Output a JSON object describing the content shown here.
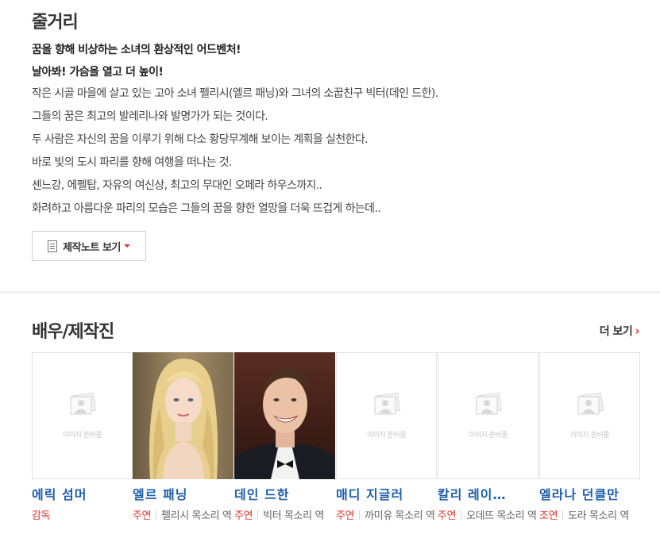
{
  "synopsis": {
    "title": "줄거리",
    "headline1": "꿈을 향해 비상하는 소녀의 환상적인 어드벤처!",
    "headline2": "날아봐! 가슴을 열고 더 높이!",
    "lines": [
      "작은 시골 마을에 살고 있는 고아 소녀 펠리시(엘르 패닝)와 그녀의 소꿉친구 빅터(데인 드한).",
      " 그들의 꿈은 최고의 발레리나와 발명가가 되는 것이다.",
      " 두 사람은 자신의 꿈을 이루기 위해 다소 황당무계해 보이는 계획을 실천한다.",
      " 바로 빛의 도시 파리를 향해 여행을 떠나는 것.",
      " 센느강, 에펠탑, 자유의 여신상, 최고의 무대인 오페라 하우스까지..",
      " 화려하고 아름다운 파리의 모습은 그들의 꿈을 향한 열망을 더욱 뜨겁게 하는데.."
    ],
    "notes_button": "제작노트 보기"
  },
  "cast": {
    "title": "배우/제작진",
    "more": "더 보기",
    "placeholder_text": "이미지 준비중",
    "members": [
      {
        "name": "에릭 섬머",
        "role_type": "감독",
        "role": "",
        "photo": "none"
      },
      {
        "name": "엘르 패닝",
        "role_type": "주연",
        "role": "펠리시 목소리 역",
        "photo": "blonde-actress"
      },
      {
        "name": "데인 드한",
        "role_type": "주연",
        "role": "빅터 목소리 역",
        "photo": "actor-in-tuxedo"
      },
      {
        "name": "매디 지글러",
        "role_type": "주연",
        "role": "까미유 목소리 역",
        "photo": "none"
      },
      {
        "name": "칼리 레이…",
        "role_type": "주연",
        "role": "오데뜨 목소리 역",
        "photo": "none"
      },
      {
        "name": "엘라나 던클만",
        "role_type": "조연",
        "role": "도라 목소리 역",
        "photo": "none"
      }
    ]
  },
  "colors": {
    "accent": "#e0332b",
    "link": "#1b5dad"
  }
}
